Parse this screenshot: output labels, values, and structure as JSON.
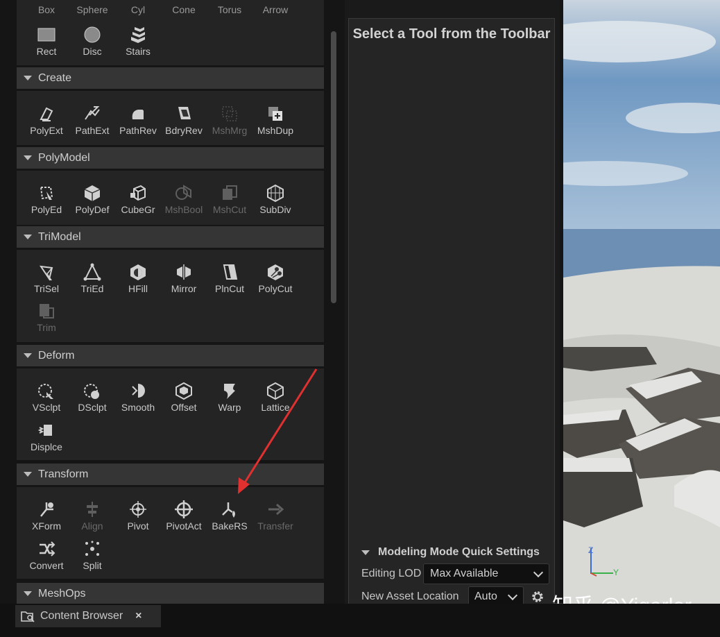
{
  "palette": {
    "top_row_labels": [
      "Box",
      "Sphere",
      "Cyl",
      "Cone",
      "Torus",
      "Arrow"
    ],
    "shapes_row2": [
      {
        "label": "Rect",
        "icon": "rect-icon",
        "enabled": true
      },
      {
        "label": "Disc",
        "icon": "disc-icon",
        "enabled": true
      },
      {
        "label": "Stairs",
        "icon": "stairs-icon",
        "enabled": true
      }
    ],
    "sections": [
      {
        "title": "Create",
        "tools": [
          {
            "label": "PolyExt",
            "icon": "polyext-icon",
            "enabled": true
          },
          {
            "label": "PathExt",
            "icon": "pathext-icon",
            "enabled": true
          },
          {
            "label": "PathRev",
            "icon": "pathrev-icon",
            "enabled": true
          },
          {
            "label": "BdryRev",
            "icon": "bdryrev-icon",
            "enabled": true
          },
          {
            "label": "MshMrg",
            "icon": "mshmrg-icon",
            "enabled": false
          },
          {
            "label": "MshDup",
            "icon": "mshdup-icon",
            "enabled": true
          }
        ]
      },
      {
        "title": "PolyModel",
        "tools": [
          {
            "label": "PolyEd",
            "icon": "polyed-icon",
            "enabled": true
          },
          {
            "label": "PolyDef",
            "icon": "polydef-icon",
            "enabled": true
          },
          {
            "label": "CubeGr",
            "icon": "cubegr-icon",
            "enabled": true
          },
          {
            "label": "MshBool",
            "icon": "mshbool-icon",
            "enabled": false
          },
          {
            "label": "MshCut",
            "icon": "mshcut-icon",
            "enabled": false
          },
          {
            "label": "SubDiv",
            "icon": "subdiv-icon",
            "enabled": true
          }
        ]
      },
      {
        "title": "TriModel",
        "tools": [
          {
            "label": "TriSel",
            "icon": "trisel-icon",
            "enabled": true
          },
          {
            "label": "TriEd",
            "icon": "tried-icon",
            "enabled": true
          },
          {
            "label": "HFill",
            "icon": "hfill-icon",
            "enabled": true
          },
          {
            "label": "Mirror",
            "icon": "mirror-icon",
            "enabled": true
          },
          {
            "label": "PlnCut",
            "icon": "plncut-icon",
            "enabled": true
          },
          {
            "label": "PolyCut",
            "icon": "polycut-icon",
            "enabled": true
          },
          {
            "label": "Trim",
            "icon": "trim-icon",
            "enabled": false
          }
        ]
      },
      {
        "title": "Deform",
        "tools": [
          {
            "label": "VSclpt",
            "icon": "vsclpt-icon",
            "enabled": true
          },
          {
            "label": "DSclpt",
            "icon": "dsclpt-icon",
            "enabled": true
          },
          {
            "label": "Smooth",
            "icon": "smooth-icon",
            "enabled": true
          },
          {
            "label": "Offset",
            "icon": "offset-icon",
            "enabled": true
          },
          {
            "label": "Warp",
            "icon": "warp-icon",
            "enabled": true
          },
          {
            "label": "Lattice",
            "icon": "lattice-icon",
            "enabled": true
          },
          {
            "label": "Displce",
            "icon": "displce-icon",
            "enabled": true
          }
        ]
      },
      {
        "title": "Transform",
        "tools": [
          {
            "label": "XForm",
            "icon": "xform-icon",
            "enabled": true
          },
          {
            "label": "Align",
            "icon": "align-icon",
            "enabled": false
          },
          {
            "label": "Pivot",
            "icon": "pivot-icon",
            "enabled": true
          },
          {
            "label": "PivotAct",
            "icon": "pivotact-icon",
            "enabled": true
          },
          {
            "label": "BakeRS",
            "icon": "bakers-icon",
            "enabled": true
          },
          {
            "label": "Transfer",
            "icon": "transfer-icon",
            "enabled": false
          },
          {
            "label": "Convert",
            "icon": "convert-icon",
            "enabled": true
          },
          {
            "label": "Split",
            "icon": "split-icon",
            "enabled": true
          }
        ]
      },
      {
        "title": "MeshOps",
        "tools": []
      }
    ]
  },
  "details": {
    "title": "Select a Tool from the Toolbar",
    "quick_settings": {
      "header": "Modeling Mode Quick Settings",
      "editing_lod_label": "Editing LOD",
      "editing_lod_value": "Max Available",
      "new_asset_location_label": "New Asset Location",
      "new_asset_location_value": "Auto"
    }
  },
  "viewport": {
    "watermark": "知乎 @Yigarlor",
    "gizmo_axes": [
      "Z",
      "Y"
    ]
  },
  "bottom": {
    "tab_label": "Content Browser",
    "close_glyph": "×"
  },
  "colors": {
    "panel_bg": "#242424",
    "header_bg": "#353535",
    "annotation_arrow": "#e03030",
    "sky": "#7ea3c8"
  }
}
